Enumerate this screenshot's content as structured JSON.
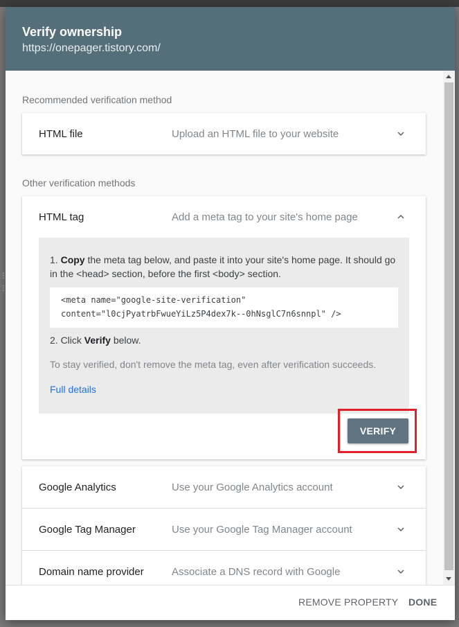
{
  "dialog": {
    "title": "Verify ownership",
    "subtitle": "https://onepager.tistory.com/"
  },
  "sections": {
    "recommended_label": "Recommended verification method",
    "other_label": "Other verification methods"
  },
  "methods": {
    "html_file": {
      "title": "HTML file",
      "description": "Upload an HTML file to your website",
      "icon": "chevron-down-icon"
    },
    "html_tag": {
      "title": "HTML tag",
      "description": "Add a meta tag to your site's home page",
      "icon": "chevron-up-icon"
    },
    "google_analytics": {
      "title": "Google Analytics",
      "description": "Use your Google Analytics account",
      "icon": "chevron-down-icon"
    },
    "google_tag_manager": {
      "title": "Google Tag Manager",
      "description": "Use your Google Tag Manager account",
      "icon": "chevron-down-icon"
    },
    "domain_provider": {
      "title": "Domain name provider",
      "description": "Associate a DNS record with Google",
      "icon": "chevron-down-icon"
    }
  },
  "html_tag_panel": {
    "step1_number": "1.",
    "step1_bold": "Copy",
    "step1_text_a": " the meta tag below, and paste it into your site's home page. It should go in the ",
    "step1_head": "<head>",
    "step1_text_b": " section, before the first ",
    "step1_body": "<body>",
    "step1_text_c": " section.",
    "meta_tag_line1": "<meta name=\"google-site-verification\"",
    "meta_tag_line2": "content=\"l0cjPyatrbFwueYiLz5P4dex7k--0hNsglC7n6snnpl\" />",
    "step2_prefix": "2. Click ",
    "step2_bold": "Verify",
    "step2_suffix": " below.",
    "note": "To stay verified, don't remove the meta tag, even after verification succeeds.",
    "full_details": "Full details",
    "verify_button": "VERIFY",
    "highlight_color": "#e0202a"
  },
  "footer": {
    "remove_property": "REMOVE PROPERTY",
    "done": "DONE"
  },
  "colors": {
    "header_bg": "#546e7a",
    "link": "#1a73e8",
    "verify_bg": "#5f7480"
  }
}
